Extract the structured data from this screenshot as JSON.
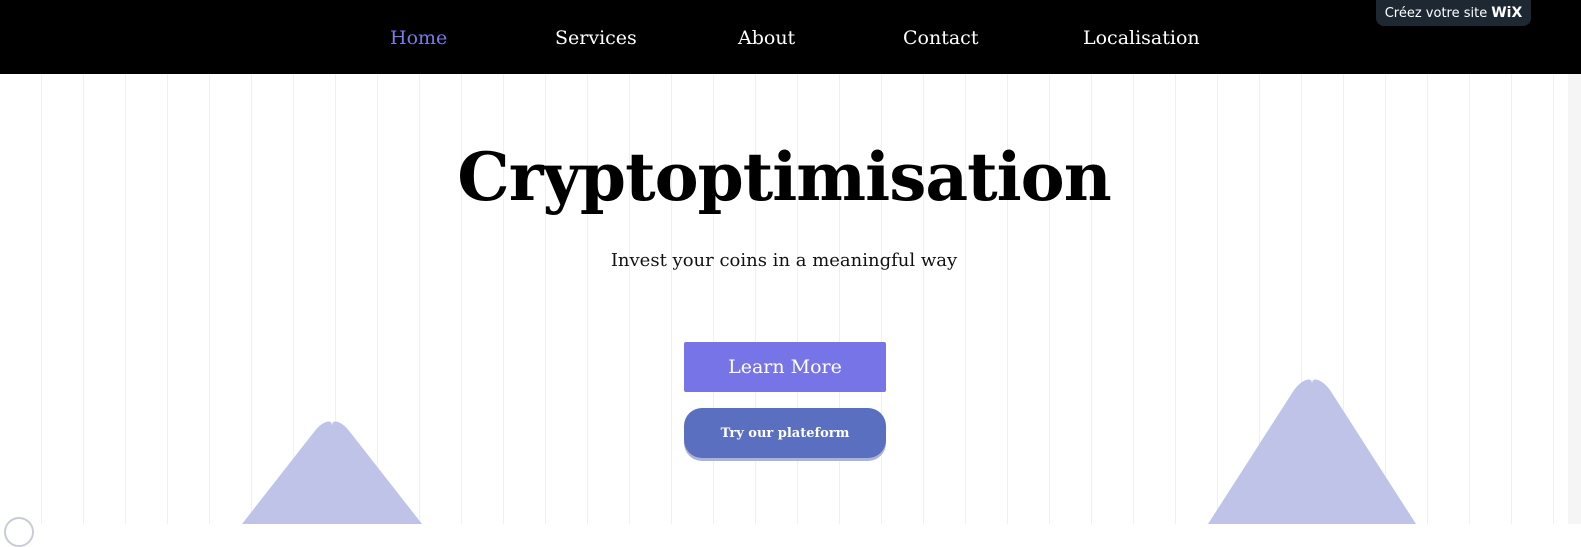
{
  "nav": {
    "items": [
      {
        "label": "Home",
        "active": true
      },
      {
        "label": "Services",
        "active": false
      },
      {
        "label": "About",
        "active": false
      },
      {
        "label": "Contact",
        "active": false
      },
      {
        "label": "Localisation",
        "active": false
      }
    ]
  },
  "wix_badge": {
    "text": "Créez votre site",
    "logo": "WiX"
  },
  "hero": {
    "title": "Cryptoptimisation",
    "subtitle": "Invest your coins in a meaningful way",
    "learn_more_label": "Learn More",
    "try_platform_label": "Try our plateform"
  },
  "colors": {
    "nav_background": "#000000",
    "accent": "#7674e6",
    "secondary_button": "#5a6fbf",
    "decorative_shape": "#c0c3e8"
  },
  "icons": {
    "decor_left": "triangle-shape",
    "decor_right": "triangle-shape"
  }
}
